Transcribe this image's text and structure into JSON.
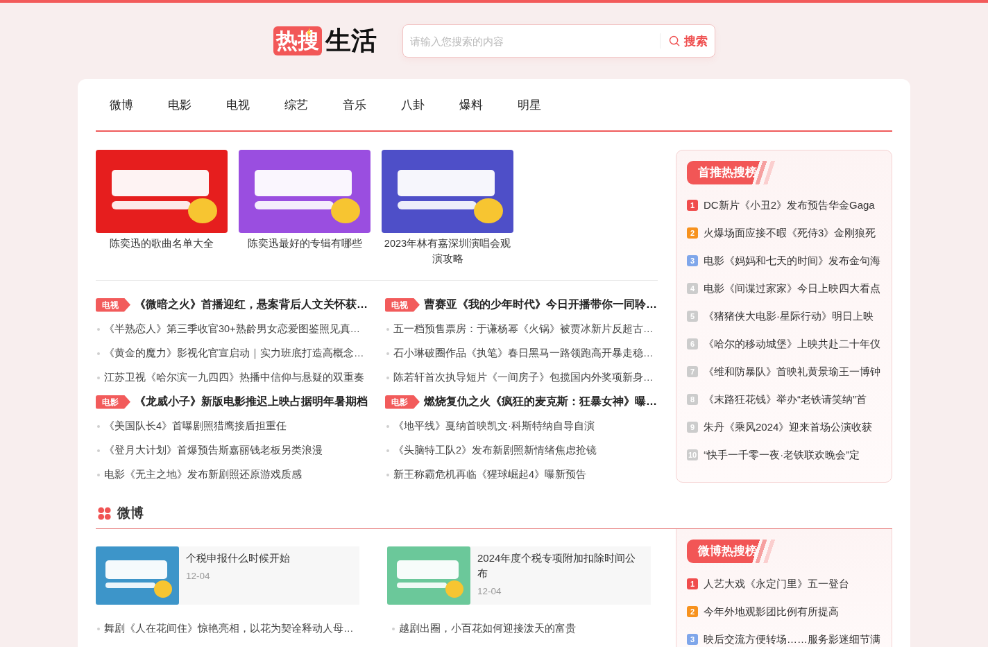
{
  "header": {
    "logo": {
      "badge": "热搜",
      "text": "生活"
    },
    "search": {
      "placeholder": "请输入您搜索的内容",
      "button": "搜索"
    }
  },
  "nav": {
    "tabs": [
      {
        "label": "微博"
      },
      {
        "label": "电影"
      },
      {
        "label": "电视"
      },
      {
        "label": "综艺"
      },
      {
        "label": "音乐"
      },
      {
        "label": "八卦"
      },
      {
        "label": "爆料"
      },
      {
        "label": "明星"
      }
    ]
  },
  "featured": [
    {
      "caption": "陈奕迅的歌曲名单大全",
      "color": "#e61e1e"
    },
    {
      "caption": "陈奕迅最好的专辑有哪些",
      "color": "#9a4ee0"
    },
    {
      "caption": "2023年林有嘉深圳演唱会观演攻略",
      "color": "#4e4fc8"
    }
  ],
  "news_columns": [
    {
      "groups": [
        {
          "tag": "电视",
          "headline": "《微暗之火》首播迎红，悬案背后人文关怀获…",
          "items": [
            "《半熟恋人》第三季收官30+熟龄男女恋爱图鉴照见真…",
            "《黄金的魔力》影视化官宣启动｜实力班底打造高概念…",
            "江苏卫视《哈尔滨一九四四》热播中信仰与悬疑的双重奏"
          ]
        },
        {
          "tag": "电影",
          "headline": "《龙威小子》新版电影推迟上映占据明年暑期档",
          "items": [
            "《美国队长4》首曝剧照猎鹰接盾担重任",
            "《登月大计划》首爆预告斯嘉丽钱老板另类浪漫",
            "电影《无主之地》发布新剧照还原游戏质感"
          ]
        }
      ]
    },
    {
      "groups": [
        {
          "tag": "电视",
          "headline": "曹赛亚《我的少年时代》今日开播带你一同聆…",
          "items": [
            "五一档预售票房：于谦杨幂《火锅》被贾冰新片反超古…",
            "石小琳破圈作品《执笔》春日黑马一路领跑高开暴走稳…",
            "陈若轩首次执导短片《一间房子》包揽国内外奖项新身…"
          ]
        },
        {
          "tag": "电影",
          "headline": "燃烧复仇之火《疯狂的麦克斯：狂暴女神》曝…",
          "items": [
            "《地平线》戛纳首映凯文·科斯特纳自导自演",
            "《头脑特工队2》发布新剧照新情绪焦虑抢镜",
            "新王称霸危机再临《猩球崛起4》曝新预告"
          ]
        }
      ]
    }
  ],
  "hot_list": {
    "title": "首推热搜榜",
    "items": [
      {
        "rank": "1",
        "text": "DC新片《小丑2》发布预告华金Gaga",
        "color": "#f04c4c"
      },
      {
        "rank": "2",
        "text": "火爆场面应接不暇《死侍3》金刚狼死",
        "color": "#f7921e"
      },
      {
        "rank": "3",
        "text": "电影《妈妈和七天的时间》发布金句海",
        "color": "#7fa6ea"
      },
      {
        "rank": "4",
        "text": "电影《间谍过家家》今日上映四大看点",
        "color": "#cccccc"
      },
      {
        "rank": "5",
        "text": "《猪猪侠大电影·星际行动》明日上映",
        "color": "#cccccc"
      },
      {
        "rank": "6",
        "text": "《哈尔的移动城堡》上映共赴二十年仪",
        "color": "#cccccc"
      },
      {
        "rank": "7",
        "text": "《维和防暴队》首映礼黄景瑜王一博钟",
        "color": "#cccccc"
      },
      {
        "rank": "8",
        "text": "《末路狂花钱》举办“老铁请笑纳”首",
        "color": "#cccccc"
      },
      {
        "rank": "9",
        "text": "朱丹《乘风2024》迎来首场公演收获",
        "color": "#cccccc"
      },
      {
        "rank": "10",
        "text": "“快手一千零一夜·老铁联欢晚会”定",
        "color": "#cccccc"
      }
    ]
  },
  "weibo_section": {
    "title": "微博",
    "cards": [
      {
        "title": "个税申报什么时候开始",
        "date": "12-04",
        "color": "#3d95c9"
      },
      {
        "title": "2024年度个税专项附加扣除时间公布",
        "date": "12-04",
        "color": "#6bc89a"
      }
    ],
    "items": [
      "舞剧《人在花间住》惊艳亮相，以花为契诠释动人母…",
      "越剧出圈，小百花如何迎接泼天的富贵"
    ],
    "hot_list": {
      "title": "微博热搜榜",
      "items": [
        {
          "rank": "1",
          "text": "人艺大戏《永定门里》五一登台",
          "color": "#f04c4c"
        },
        {
          "rank": "2",
          "text": "今年外地观影团比例有所提高",
          "color": "#f7921e"
        },
        {
          "rank": "3",
          "text": "映后交流方便转场……服务影迷细节满",
          "color": "#7fa6ea"
        }
      ]
    }
  }
}
